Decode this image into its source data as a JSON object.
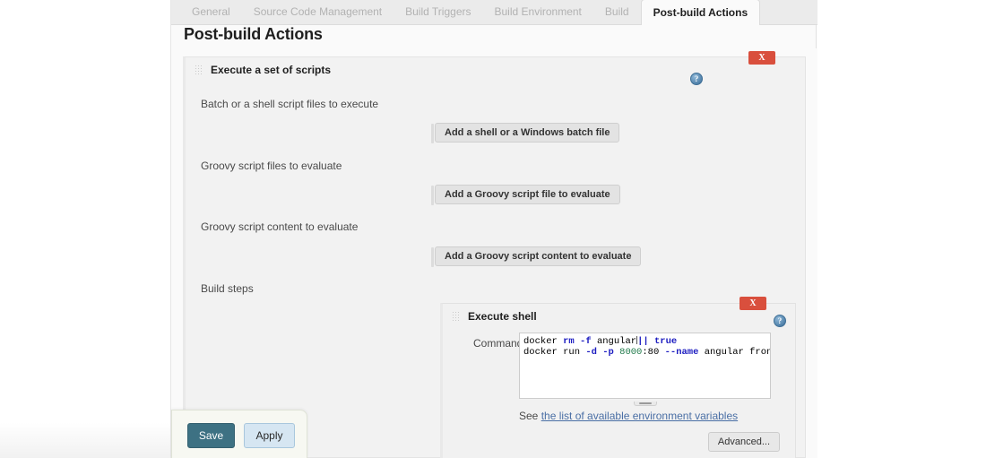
{
  "tabs": [
    {
      "label": "General",
      "active": false
    },
    {
      "label": "Source Code Management",
      "active": false
    },
    {
      "label": "Build Triggers",
      "active": false
    },
    {
      "label": "Build Environment",
      "active": false
    },
    {
      "label": "Build",
      "active": false
    },
    {
      "label": "Post-build Actions",
      "active": true
    }
  ],
  "page": {
    "title": "Post-build Actions"
  },
  "outer_block": {
    "title": "Execute a set of scripts",
    "help_icon": "?",
    "delete_label": "X",
    "rows": [
      {
        "label": "Batch or a shell script files to execute",
        "button": "Add a shell or a Windows batch file"
      },
      {
        "label": "Groovy script files to evaluate",
        "button": "Add a Groovy script file to evaluate"
      },
      {
        "label": "Groovy script content to evaluate",
        "button": "Add a Groovy script content to evaluate"
      },
      {
        "label": "Build steps",
        "button": ""
      }
    ]
  },
  "inner_block": {
    "title": "Execute shell",
    "help_icon": "?",
    "delete_label": "X",
    "command_label": "Command",
    "command_lines": [
      {
        "segments": [
          {
            "text": "docker ",
            "style": "plain"
          },
          {
            "text": "rm",
            "style": "kw"
          },
          {
            "text": " ",
            "style": "plain"
          },
          {
            "text": "-f",
            "style": "kw"
          },
          {
            "text": " angular",
            "style": "plain"
          },
          {
            "text": "||",
            "style": "kw"
          },
          {
            "text": " ",
            "style": "plain"
          },
          {
            "text": "true",
            "style": "kw"
          }
        ]
      },
      {
        "segments": [
          {
            "text": "docker run ",
            "style": "plain"
          },
          {
            "text": "-d",
            "style": "kw"
          },
          {
            "text": " ",
            "style": "plain"
          },
          {
            "text": "-p",
            "style": "kw"
          },
          {
            "text": " ",
            "style": "plain"
          },
          {
            "text": "8000",
            "style": "num"
          },
          {
            "text": ":80 ",
            "style": "plain"
          },
          {
            "text": "--name",
            "style": "kw"
          },
          {
            "text": " angular fronten",
            "style": "plain"
          }
        ]
      }
    ],
    "see_prefix": "See ",
    "see_link": "the list of available environment variables",
    "advanced_button": "Advanced..."
  },
  "savebar": {
    "save_label": "Save",
    "apply_label": "Apply"
  },
  "colors": {
    "accent_save": "#3d7183",
    "accent_apply": "#d6e6f2",
    "delete_red": "#d94f3d",
    "link_blue": "#4a6fa5"
  }
}
